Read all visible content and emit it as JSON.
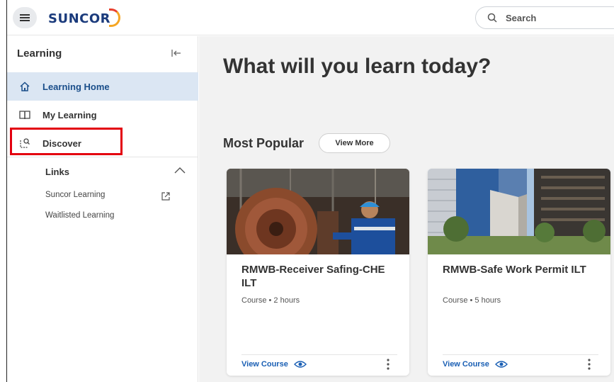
{
  "header": {
    "logo_text": "SUNCOR",
    "search_label": "Search"
  },
  "sidebar": {
    "title": "Learning",
    "items": [
      {
        "label": "Learning Home",
        "icon": "home-icon",
        "active": true
      },
      {
        "label": "My Learning",
        "icon": "book-icon",
        "active": false
      },
      {
        "label": "Discover",
        "icon": "discover-icon",
        "active": false
      }
    ],
    "links_header": "Links",
    "links": [
      {
        "label": "Suncor Learning",
        "external": true
      },
      {
        "label": "Waitlisted Learning",
        "external": false
      }
    ]
  },
  "main": {
    "hero_title": "What will you learn today?",
    "section_title": "Most Popular",
    "view_more_label": "View More",
    "cards": [
      {
        "title": "RMWB-Receiver Safing-CHE ILT",
        "meta": "Course • 2 hours",
        "link_label": "View Course"
      },
      {
        "title": "RMWB-Safe Work Permit ILT",
        "meta": "Course • 5 hours",
        "link_label": "View Course"
      }
    ]
  },
  "colors": {
    "accent": "#1a5fb4",
    "active_bg": "#dbe6f3",
    "highlight_border": "#e3000f",
    "brand_blue": "#1b3b7c"
  }
}
